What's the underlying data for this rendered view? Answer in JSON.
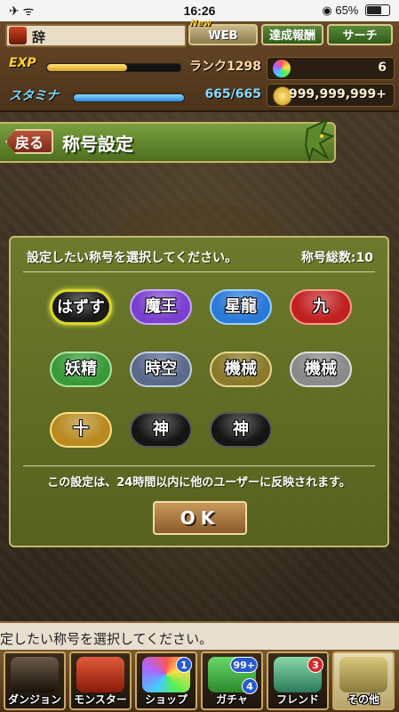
{
  "statusbar": {
    "time": "16:26",
    "battery": "65%",
    "icons_left": "✈ ᯤ",
    "icons_right": "◉"
  },
  "header": {
    "username": "辞",
    "new_tag": "New",
    "web_label": "WEB",
    "achievements_label": "達成報酬",
    "search_label": "サーチ",
    "exp_label": "EXP",
    "rank_label": "ランク1298",
    "exp_fraction": 0.6,
    "stamina_label": "スタミナ",
    "stamina_value": "665/665",
    "stamina_fraction": 1.0,
    "magic_stones": "6",
    "coins": "999,999,999+"
  },
  "titlebar": {
    "back_label": "戻る",
    "title": "称号設定"
  },
  "panel": {
    "instruction": "設定したい称号を選択してください。",
    "count": "称号総数:10",
    "titles": [
      {
        "label": "はずす",
        "color": "#1a1a1a",
        "border": "#d8d82a"
      },
      {
        "label": "魔王",
        "color": "#7a40d0",
        "border": "#c8a8ff"
      },
      {
        "label": "星龍",
        "color": "#2a7ad8",
        "border": "#9cd0ff"
      },
      {
        "label": "九",
        "color": "#c02020",
        "border": "#ff9a8a"
      },
      {
        "label": "妖精",
        "color": "#3a9a3a",
        "border": "#a8e8a0"
      },
      {
        "label": "時空",
        "color": "#5a6a8a",
        "border": "#c0d0e8"
      },
      {
        "label": "機械",
        "color": "#8a7a2a",
        "border": "#e8d890"
      },
      {
        "label": "機械",
        "color": "#8a8a8a",
        "border": "#e0e0e0"
      },
      {
        "label": "十",
        "color": "#b88a20",
        "border": "#ffe080"
      },
      {
        "label": "神",
        "color": "#151515",
        "border": "#555555"
      },
      {
        "label": "神",
        "color": "#151515",
        "border": "#555555"
      }
    ],
    "note": "この設定は、24時間以内に他のユーザーに反映されます。",
    "ok_label": "OK"
  },
  "ticker": "定したい称号を選択してください。",
  "nav": [
    {
      "label": "ダンジョン",
      "badge": "",
      "badge2": ""
    },
    {
      "label": "モンスター",
      "badge": "",
      "badge2": ""
    },
    {
      "label": "ショップ",
      "badge": "1",
      "badge2": ""
    },
    {
      "label": "ガチャ",
      "badge": "99+",
      "badge2": "4"
    },
    {
      "label": "フレンド",
      "badge": "3",
      "badge2": ""
    },
    {
      "label": "その他",
      "badge": "",
      "badge2": ""
    }
  ]
}
